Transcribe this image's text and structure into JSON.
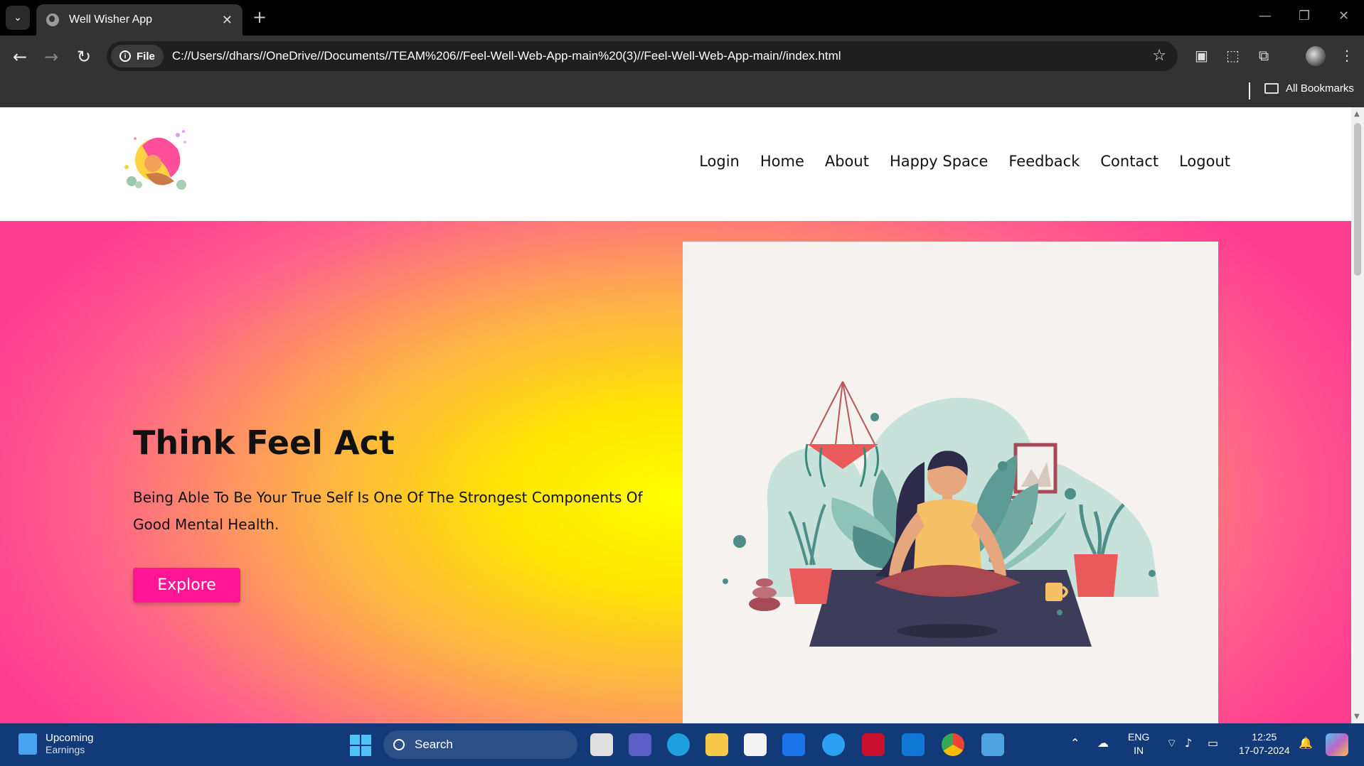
{
  "browser": {
    "tab_title": "Well Wisher App",
    "tab_close": "✕",
    "new_tab": "+",
    "file_chip": "File",
    "url": "C://Users//dhars//OneDrive//Documents//TEAM%206//Feel-Well-Web-App-main%20(3)//Feel-Well-Web-App-main//index.html",
    "bookmarks_label": "All Bookmarks"
  },
  "site": {
    "nav": [
      "Login",
      "Home",
      "About",
      "Happy Space",
      "Feedback",
      "Contact",
      "Logout"
    ],
    "hero": {
      "title": "Think Feel Act",
      "text": "Being Able To Be Your True Self Is One Of The Strongest Components Of Good Mental Health.",
      "button": "Explore"
    },
    "colors": {
      "accent": "#ff1493",
      "hero_center": "#ffff00",
      "hero_edge": "#ff3d8f"
    }
  },
  "taskbar": {
    "widget_title": "Upcoming",
    "widget_sub": "Earnings",
    "search_placeholder": "Search",
    "lang_top": "ENG",
    "lang_bottom": "IN",
    "time": "12:25",
    "date": "17-07-2024"
  }
}
